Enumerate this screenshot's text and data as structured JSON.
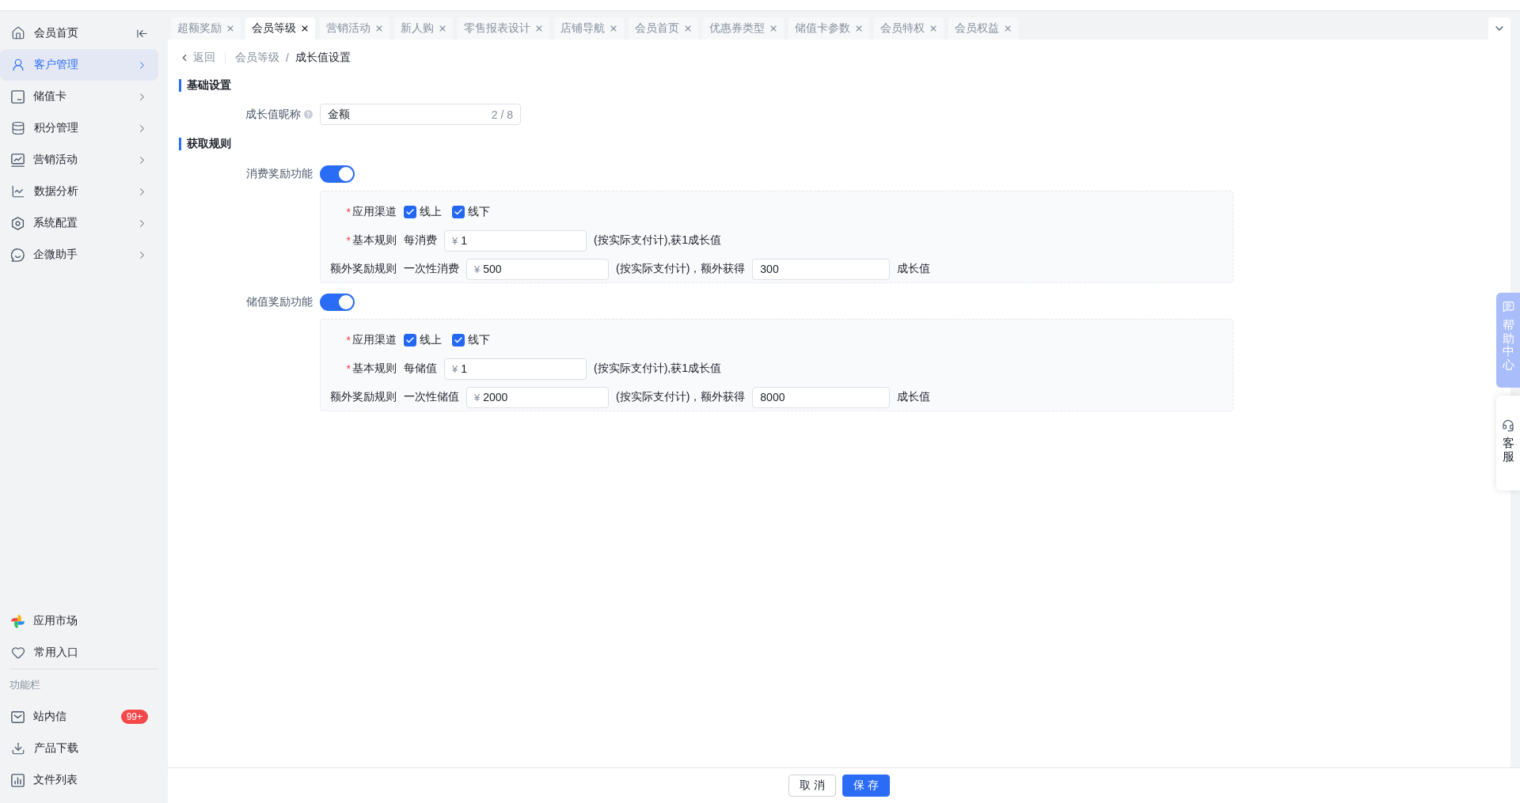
{
  "sidebar": {
    "items": [
      {
        "label": "会员首页",
        "selected": false
      },
      {
        "label": "客户管理",
        "selected": true
      },
      {
        "label": "储值卡",
        "selected": false
      },
      {
        "label": "积分管理",
        "selected": false
      },
      {
        "label": "营销活动",
        "selected": false
      },
      {
        "label": "数据分析",
        "selected": false
      },
      {
        "label": "系统配置",
        "selected": false
      },
      {
        "label": "企微助手",
        "selected": false
      }
    ],
    "bottom_items": [
      {
        "label": "应用市场"
      },
      {
        "label": "常用入口"
      }
    ],
    "section_label": "功能栏",
    "tools": [
      {
        "label": "站内信",
        "badge": "99+"
      },
      {
        "label": "产品下载"
      },
      {
        "label": "文件列表"
      }
    ]
  },
  "tabs": [
    {
      "label": "超额奖励",
      "selected": false
    },
    {
      "label": "会员等级",
      "selected": true
    },
    {
      "label": "营销活动",
      "selected": false
    },
    {
      "label": "新人购",
      "selected": false
    },
    {
      "label": "零售报表设计",
      "selected": false
    },
    {
      "label": "店铺导航",
      "selected": false
    },
    {
      "label": "会员首页",
      "selected": false
    },
    {
      "label": "优惠券类型",
      "selected": false
    },
    {
      "label": "储值卡参数",
      "selected": false
    },
    {
      "label": "会员特权",
      "selected": false
    },
    {
      "label": "会员权益",
      "selected": false
    }
  ],
  "breadcrumb": {
    "back": "返回",
    "separator": "/",
    "items": [
      {
        "label": "会员等级",
        "current": false
      },
      {
        "label": "成长值设置",
        "current": true
      }
    ]
  },
  "basic": {
    "title": "基础设置",
    "nickname": {
      "label": "成长值昵称",
      "value": "金额",
      "counter": "2 / 8"
    }
  },
  "rules": {
    "title": "获取规则",
    "groups": [
      {
        "label": "消费奖励功能",
        "on": true,
        "rows": [
          {
            "kind": "channels",
            "mark": "*",
            "label": "应用渠道",
            "options": [
              {
                "label": "线上",
                "checked": true
              },
              {
                "label": "线下",
                "checked": true
              }
            ]
          },
          {
            "kind": "basic",
            "mark": "*",
            "label": "基本规则",
            "prefix": "每消费",
            "currency": "¥",
            "value": "1",
            "note": "(按实际支付计),获1成长值"
          },
          {
            "kind": "extra",
            "label": "额外奖励规则",
            "prefix": "一次性消费",
            "currency": "¥",
            "value": "500",
            "note": "(按实际支付计)，额外获得",
            "reward": "300",
            "unit": "成长值"
          }
        ]
      },
      {
        "label": "储值奖励功能",
        "on": true,
        "rows": [
          {
            "kind": "channels",
            "mark": "*",
            "label": "应用渠道",
            "options": [
              {
                "label": "线上",
                "checked": true
              },
              {
                "label": "线下",
                "checked": true
              }
            ]
          },
          {
            "kind": "basic",
            "mark": "*",
            "label": "基本规则",
            "prefix": "每储值",
            "currency": "¥",
            "value": "1",
            "note": "(按实际支付计),获1成长值"
          },
          {
            "kind": "extra",
            "label": "额外奖励规则",
            "prefix": "一次性储值",
            "currency": "¥",
            "value": "2000",
            "note": "(按实际支付计)，额外获得",
            "reward": "8000",
            "unit": "成长值"
          }
        ]
      }
    ]
  },
  "actions": [
    {
      "label": "取 消",
      "kind": "secondary"
    },
    {
      "label": "保 存",
      "kind": "primary"
    }
  ],
  "float_tabs": [
    {
      "label": "帮助中心",
      "kind": "help"
    },
    {
      "label": "客服",
      "kind": "service"
    }
  ]
}
